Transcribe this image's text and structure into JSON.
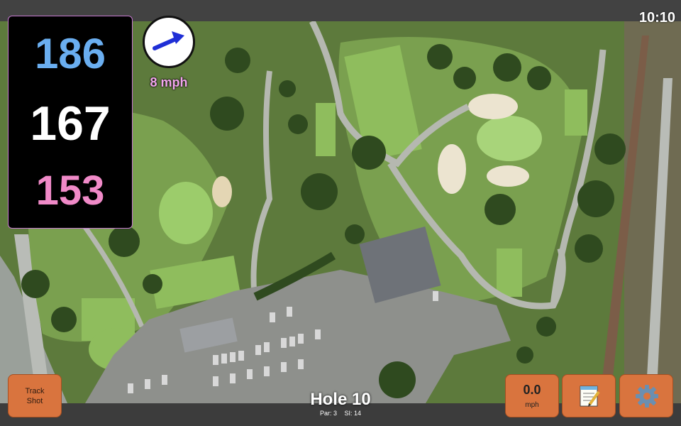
{
  "status": {
    "time": "10:10"
  },
  "distances": {
    "back": {
      "value": "186",
      "color": "#6aaef0"
    },
    "middle": {
      "value": "167",
      "color": "#ffffff"
    },
    "front": {
      "value": "153",
      "color": "#f08ac8"
    }
  },
  "wind": {
    "speed_label": "8 mph",
    "arrow_icon": "arrow-right-up-icon",
    "arrow_color": "#1f2fd6",
    "label_color": "#f3a6ee"
  },
  "track_shot": {
    "label": "Track\nShot"
  },
  "speed": {
    "value": "0.0",
    "unit": "mph"
  },
  "notes": {
    "icon": "notepad-icon"
  },
  "settings": {
    "icon": "gear-icon"
  },
  "hole": {
    "title": "Hole 10",
    "par": "Par: 3",
    "si": "SI: 14"
  },
  "colors": {
    "accent": "#d9743e",
    "panel_border": "#c87ad2"
  }
}
